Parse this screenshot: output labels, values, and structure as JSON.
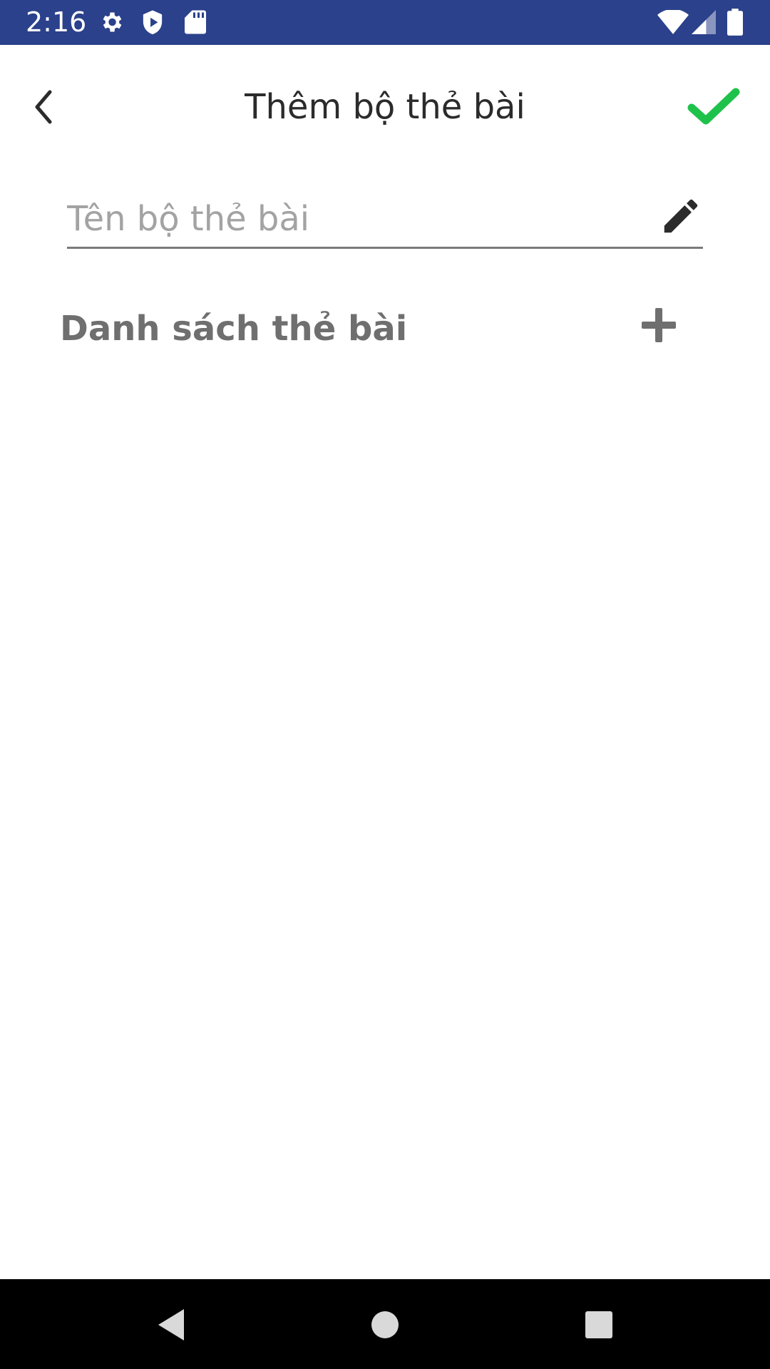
{
  "status_bar": {
    "time": "2:16",
    "icons": [
      "settings-icon",
      "shield-play-icon",
      "sd-card-icon",
      "wifi-icon",
      "signal-icon",
      "battery-icon"
    ]
  },
  "app_bar": {
    "title": "Thêm bộ thẻ bài",
    "back_icon": "chevron-left-icon",
    "confirm_icon": "checkmark-icon",
    "confirm_color": "#1ec24b"
  },
  "form": {
    "name_placeholder": "Tên bộ thẻ bài",
    "name_value": "",
    "edit_icon": "pencil-icon"
  },
  "card_list": {
    "header": "Danh sách thẻ bài",
    "add_icon": "plus-icon"
  },
  "nav_bar": {
    "icons": [
      "nav-back-icon",
      "nav-home-icon",
      "nav-recents-icon"
    ]
  }
}
